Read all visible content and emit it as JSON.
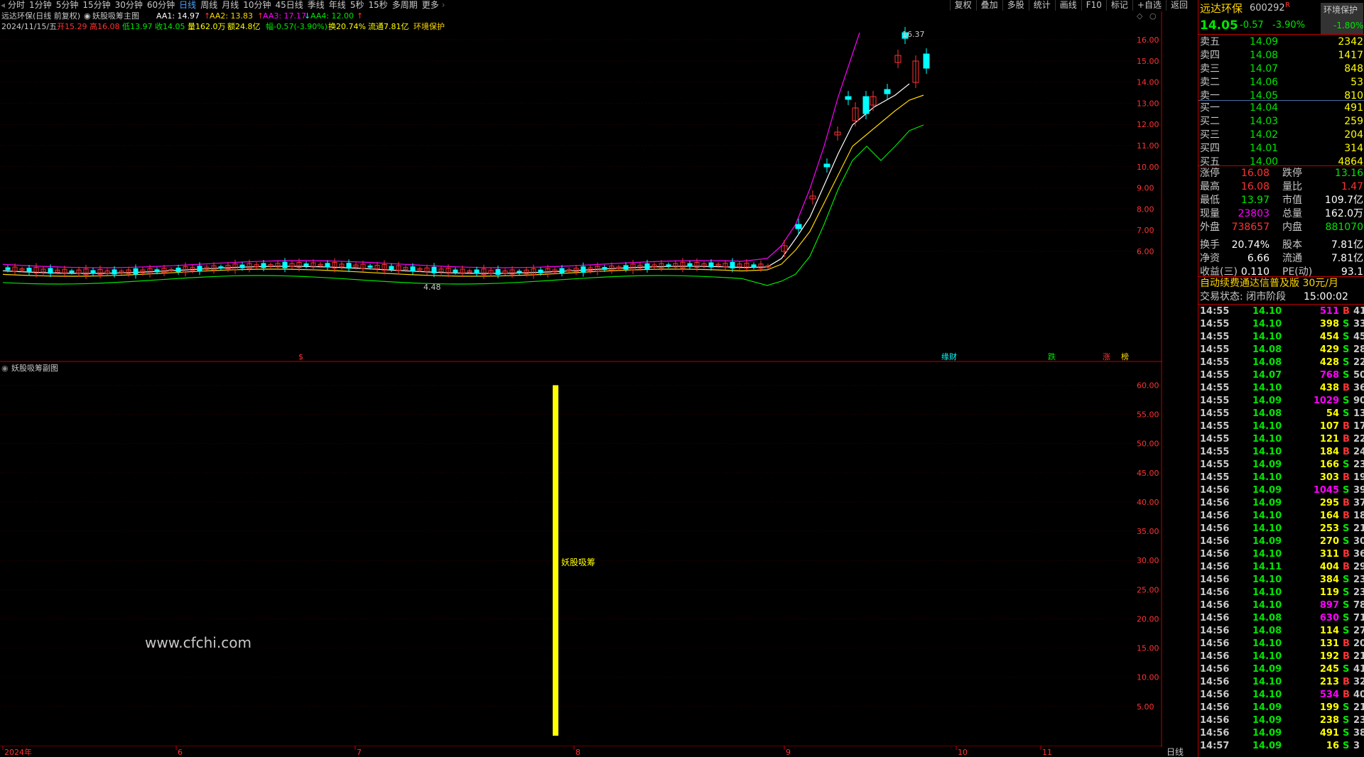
{
  "periods": [
    "分时",
    "1分钟",
    "5分钟",
    "15分钟",
    "30分钟",
    "60分钟",
    "日线",
    "周线",
    "月线",
    "10分钟",
    "45日线",
    "季线",
    "年线",
    "5秒",
    "15秒",
    "多周期",
    "更多"
  ],
  "active_period": "日线",
  "toolbar": [
    "复权",
    "叠加",
    "多股",
    "统计",
    "画线",
    "F10",
    "标记",
    "+自选",
    "返回"
  ],
  "main": {
    "title_line": "远达环保(日线 前复权)",
    "indicator_name": "妖股吸筹主图",
    "aa1": "AA1: 14.97",
    "aa2": "AA2: 13.83",
    "aa3": "AA3: 17.17",
    "aa4": "AA4: 12.00",
    "date": "2024/11/15/五",
    "open": "开15.29",
    "high": "高16.08",
    "low": "低13.97",
    "close": "收14.05",
    "vol": "量162.0万",
    "amount": "额24.8亿",
    "change": "幅-0.57(-3.90%)",
    "turnover": "换20.74%",
    "float": "流通7.81亿",
    "sector": "环境保护",
    "label_peak": "16.37",
    "label_low": "4.48",
    "event_marks": [
      "$",
      "缘财",
      "跌",
      "涨",
      "榜"
    ],
    "price_ticks": [
      "16.00",
      "15.00",
      "14.00",
      "13.00",
      "12.00",
      "11.00",
      "10.00",
      "9.00",
      "8.00",
      "7.00",
      "6.00"
    ]
  },
  "sub": {
    "title": "妖股吸筹副图",
    "bar_label": "妖股吸筹",
    "ticks": [
      "60.00",
      "55.00",
      "50.00",
      "45.00",
      "40.00",
      "35.00",
      "30.00",
      "25.00",
      "20.00",
      "15.00",
      "10.00",
      "5.00"
    ],
    "watermark": "www.cfchi.com"
  },
  "xaxis": {
    "labels": [
      "2024年",
      "6",
      "7",
      "8",
      "9",
      "10",
      "11"
    ],
    "right_label": "日线"
  },
  "chart_data": {
    "type": "bar",
    "title": "妖股吸筹副图",
    "series": [
      {
        "name": "妖股吸筹",
        "values": [
          60
        ]
      }
    ],
    "ylim": [
      0,
      62
    ]
  },
  "panel": {
    "name": "远达环保",
    "code": "600292",
    "code_flag": "R",
    "sector_btn": "环境保护",
    "sector_chg": "-1.80%",
    "price": "14.05",
    "chg": "-0.57",
    "pct": "-3.90%",
    "asks": [
      {
        "label": "卖五",
        "price": "14.09",
        "vol": "2342"
      },
      {
        "label": "卖四",
        "price": "14.08",
        "vol": "1417"
      },
      {
        "label": "卖三",
        "price": "14.07",
        "vol": "848"
      },
      {
        "label": "卖二",
        "price": "14.06",
        "vol": "53"
      },
      {
        "label": "卖一",
        "price": "14.05",
        "vol": "810"
      }
    ],
    "bids": [
      {
        "label": "买一",
        "price": "14.04",
        "vol": "491"
      },
      {
        "label": "买二",
        "price": "14.03",
        "vol": "259"
      },
      {
        "label": "买三",
        "price": "14.02",
        "vol": "204"
      },
      {
        "label": "买四",
        "price": "14.01",
        "vol": "314"
      },
      {
        "label": "买五",
        "price": "14.00",
        "vol": "4864"
      }
    ],
    "stats": [
      {
        "l1": "涨停",
        "v1": "16.08",
        "c1": "red",
        "l2": "跌停",
        "v2": "13.16",
        "c2": "green"
      },
      {
        "l1": "最高",
        "v1": "16.08",
        "c1": "red",
        "l2": "量比",
        "v2": "1.47",
        "c2": "red"
      },
      {
        "l1": "最低",
        "v1": "13.97",
        "c1": "green",
        "l2": "市值",
        "v2": "109.7亿",
        "c2": "white"
      },
      {
        "l1": "现量",
        "v1": "23803",
        "c1": "magenta",
        "l2": "总量",
        "v2": "162.0万",
        "c2": "white"
      },
      {
        "l1": "外盘",
        "v1": "738657",
        "c1": "red",
        "l2": "内盘",
        "v2": "881070",
        "c2": "green"
      },
      {
        "l1": "换手",
        "v1": "20.74%",
        "c1": "white",
        "l2": "股本",
        "v2": "7.81亿",
        "c2": "white"
      },
      {
        "l1": "净资",
        "v1": "6.66",
        "c1": "white",
        "l2": "流通",
        "v2": "7.81亿",
        "c2": "white"
      },
      {
        "l1": "收益(三)",
        "v1": "0.110",
        "c1": "white",
        "l2": "PE(动)",
        "v2": "93.1",
        "c2": "white"
      }
    ],
    "ad": "自动续费通达信普及版  30元/月",
    "status_label": "交易状态: 闭市阶段",
    "status_time": "15:00:02",
    "ticks": [
      [
        "14:55",
        "14.10",
        "511",
        "B",
        "41"
      ],
      [
        "14:55",
        "14.10",
        "398",
        "S",
        "33"
      ],
      [
        "14:55",
        "14.10",
        "454",
        "S",
        "45"
      ],
      [
        "14:55",
        "14.08",
        "429",
        "S",
        "28"
      ],
      [
        "14:55",
        "14.08",
        "428",
        "S",
        "22"
      ],
      [
        "14:55",
        "14.07",
        "768",
        "S",
        "50"
      ],
      [
        "14:55",
        "14.10",
        "438",
        "B",
        "36"
      ],
      [
        "14:55",
        "14.09",
        "1029",
        "S",
        "90"
      ],
      [
        "14:55",
        "14.08",
        "54",
        "S",
        "13"
      ],
      [
        "14:55",
        "14.10",
        "107",
        "B",
        "17"
      ],
      [
        "14:55",
        "14.10",
        "121",
        "B",
        "22"
      ],
      [
        "14:55",
        "14.10",
        "184",
        "B",
        "24"
      ],
      [
        "14:55",
        "14.09",
        "166",
        "S",
        "23"
      ],
      [
        "14:55",
        "14.10",
        "303",
        "B",
        "19"
      ],
      [
        "14:56",
        "14.09",
        "1045",
        "S",
        "39"
      ],
      [
        "14:56",
        "14.09",
        "295",
        "B",
        "37"
      ],
      [
        "14:56",
        "14.10",
        "164",
        "B",
        "18"
      ],
      [
        "14:56",
        "14.10",
        "253",
        "S",
        "21"
      ],
      [
        "14:56",
        "14.09",
        "270",
        "S",
        "30"
      ],
      [
        "14:56",
        "14.10",
        "311",
        "B",
        "36"
      ],
      [
        "14:56",
        "14.11",
        "404",
        "B",
        "29"
      ],
      [
        "14:56",
        "14.10",
        "384",
        "S",
        "23"
      ],
      [
        "14:56",
        "14.10",
        "119",
        "S",
        "23"
      ],
      [
        "14:56",
        "14.10",
        "897",
        "S",
        "78"
      ],
      [
        "14:56",
        "14.08",
        "630",
        "S",
        "71"
      ],
      [
        "14:56",
        "14.08",
        "114",
        "S",
        "27"
      ],
      [
        "14:56",
        "14.10",
        "131",
        "B",
        "20"
      ],
      [
        "14:56",
        "14.10",
        "192",
        "B",
        "21"
      ],
      [
        "14:56",
        "14.09",
        "245",
        "S",
        "41"
      ],
      [
        "14:56",
        "14.10",
        "213",
        "B",
        "32"
      ],
      [
        "14:56",
        "14.10",
        "534",
        "B",
        "40"
      ],
      [
        "14:56",
        "14.09",
        "199",
        "S",
        "21"
      ],
      [
        "14:56",
        "14.09",
        "238",
        "S",
        "23"
      ],
      [
        "14:56",
        "14.09",
        "491",
        "S",
        "38"
      ],
      [
        "14:57",
        "14.09",
        "16",
        "S",
        "3"
      ]
    ]
  },
  "colors": {
    "up": "#ff3232",
    "down": "#00ffff",
    "accent": "#c00000",
    "ma1": "#ffffff",
    "ma2": "#ffd700",
    "ma3": "#ff00ff",
    "ma4": "#00e600",
    "bar": "#ffff00"
  }
}
